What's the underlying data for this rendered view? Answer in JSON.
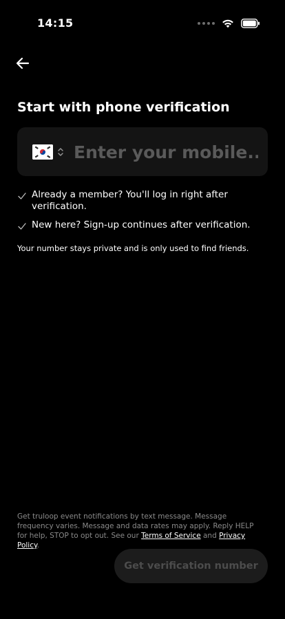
{
  "status_bar": {
    "time": "14:15",
    "icons": [
      "signal-dots-icon",
      "wifi-icon",
      "battery-icon"
    ]
  },
  "header": {
    "back_icon": "arrow-left-icon",
    "title": "Start with phone verification"
  },
  "phone_input": {
    "country_flag": "south-korea-flag-icon",
    "selector_icon": "chevron-up-down-icon",
    "placeholder": "Enter your mobile...",
    "value": ""
  },
  "info": {
    "items": [
      {
        "icon": "check-icon",
        "text": "Already a member? You'll log in right after verification."
      },
      {
        "icon": "check-icon",
        "text": "New here? Sign-up continues after verification."
      }
    ],
    "privacy_note": "Your number stays private and is only used to find friends."
  },
  "legal": {
    "prefix": "Get truloop event notifications by text message. Message frequency varies. Message and data rates may apply. Reply HELP for help, STOP to opt out. See our ",
    "terms_link": "Terms of Service",
    "connector": " and ",
    "privacy_link": "Privacy Policy",
    "suffix": "."
  },
  "cta": {
    "label": "Get verification number",
    "enabled": false
  },
  "colors": {
    "background": "#000000",
    "input_background": "#141414",
    "button_disabled_background": "#1c1c1c",
    "button_disabled_text": "#4c4c4c",
    "legal_text": "#8a8a8a"
  }
}
